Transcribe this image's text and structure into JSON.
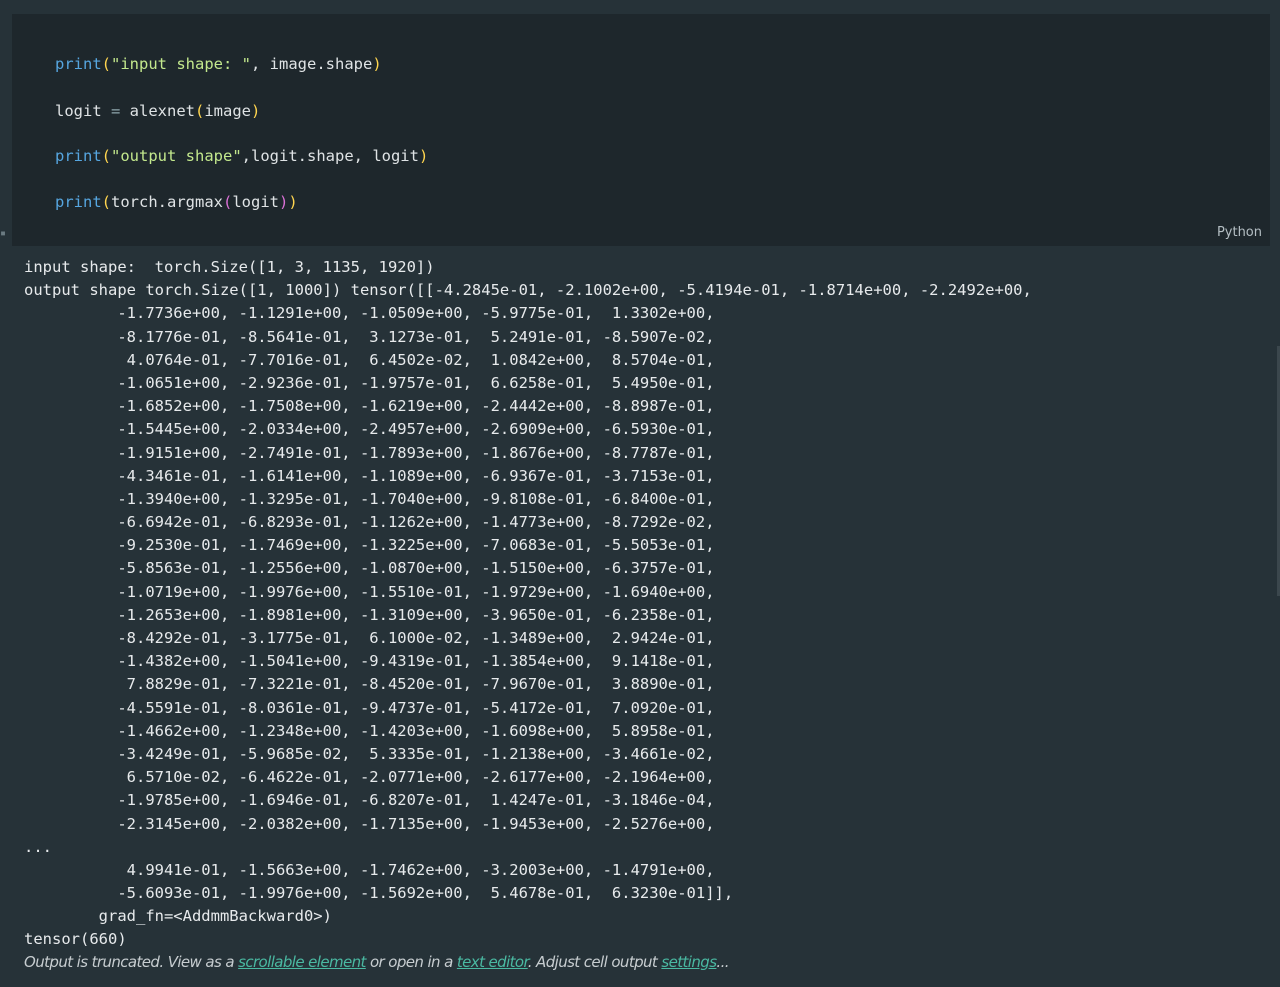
{
  "code_cell": {
    "language_label": "Python",
    "lines": [
      [
        {
          "t": "print",
          "c": "kw"
        },
        {
          "t": "(",
          "c": "paren"
        },
        {
          "t": "\"input shape: \"",
          "c": "str"
        },
        {
          "t": ", image.shape",
          "c": ""
        },
        {
          "t": ")",
          "c": "paren"
        }
      ],
      [
        {
          "t": "logit ",
          "c": ""
        },
        {
          "t": "=",
          "c": "op"
        },
        {
          "t": " alexnet",
          "c": ""
        },
        {
          "t": "(",
          "c": "paren"
        },
        {
          "t": "image",
          "c": ""
        },
        {
          "t": ")",
          "c": "paren"
        }
      ],
      [
        {
          "t": "print",
          "c": "kw"
        },
        {
          "t": "(",
          "c": "paren"
        },
        {
          "t": "\"output shape\"",
          "c": "str"
        },
        {
          "t": ",logit.shape, logit",
          "c": ""
        },
        {
          "t": ")",
          "c": "paren"
        }
      ],
      [
        {
          "t": "print",
          "c": "kw"
        },
        {
          "t": "(",
          "c": "paren"
        },
        {
          "t": "torch.argmax",
          "c": ""
        },
        {
          "t": "(",
          "c": "paren2"
        },
        {
          "t": "logit",
          "c": ""
        },
        {
          "t": ")",
          "c": "paren2"
        },
        {
          "t": ")",
          "c": "paren"
        }
      ]
    ]
  },
  "output": {
    "lines": [
      "input shape:  torch.Size([1, 3, 1135, 1920])",
      "output shape torch.Size([1, 1000]) tensor([[-4.2845e-01, -2.1002e+00, -5.4194e-01, -1.8714e+00, -2.2492e+00,",
      "          -1.7736e+00, -1.1291e+00, -1.0509e+00, -5.9775e-01,  1.3302e+00,",
      "          -8.1776e-01, -8.5641e-01,  3.1273e-01,  5.2491e-01, -8.5907e-02,",
      "           4.0764e-01, -7.7016e-01,  6.4502e-02,  1.0842e+00,  8.5704e-01,",
      "          -1.0651e+00, -2.9236e-01, -1.9757e-01,  6.6258e-01,  5.4950e-01,",
      "          -1.6852e+00, -1.7508e+00, -1.6219e+00, -2.4442e+00, -8.8987e-01,",
      "          -1.5445e+00, -2.0334e+00, -2.4957e+00, -2.6909e+00, -6.5930e-01,",
      "          -1.9151e+00, -2.7491e-01, -1.7893e+00, -1.8676e+00, -8.7787e-01,",
      "          -4.3461e-01, -1.6141e+00, -1.1089e+00, -6.9367e-01, -3.7153e-01,",
      "          -1.3940e+00, -1.3295e-01, -1.7040e+00, -9.8108e-01, -6.8400e-01,",
      "          -6.6942e-01, -6.8293e-01, -1.1262e+00, -1.4773e+00, -8.7292e-02,",
      "          -9.2530e-01, -1.7469e+00, -1.3225e+00, -7.0683e-01, -5.5053e-01,",
      "          -5.8563e-01, -1.2556e+00, -1.0870e+00, -1.5150e+00, -6.3757e-01,",
      "          -1.0719e+00, -1.9976e+00, -1.5510e-01, -1.9729e+00, -1.6940e+00,",
      "          -1.2653e+00, -1.8981e+00, -1.3109e+00, -3.9650e-01, -6.2358e-01,",
      "          -8.4292e-01, -3.1775e-01,  6.1000e-02, -1.3489e+00,  2.9424e-01,",
      "          -1.4382e+00, -1.5041e+00, -9.4319e-01, -1.3854e+00,  9.1418e-01,",
      "           7.8829e-01, -7.3221e-01, -8.4520e-01, -7.9670e-01,  3.8890e-01,",
      "          -4.5591e-01, -8.0361e-01, -9.4737e-01, -5.4172e-01,  7.0920e-01,",
      "          -1.4662e+00, -1.2348e+00, -1.4203e+00, -1.6098e+00,  5.8958e-01,",
      "          -3.4249e-01, -5.9685e-02,  5.3335e-01, -1.2138e+00, -3.4661e-02,",
      "           6.5710e-02, -6.4622e-01, -2.0771e+00, -2.6177e+00, -2.1964e+00,",
      "          -1.9785e+00, -1.6946e-01, -6.8207e-01,  1.4247e-01, -3.1846e-04,",
      "          -2.3145e+00, -2.0382e+00, -1.7135e+00, -1.9453e+00, -2.5276e+00,",
      "...",
      "           4.9941e-01, -1.5663e+00, -1.7462e+00, -3.2003e+00, -1.4791e+00,",
      "          -5.6093e-01, -1.9976e+00, -1.5692e+00,  5.4678e-01,  6.3230e-01]],",
      "        grad_fn=<AddmmBackward0>)",
      "tensor(660)"
    ]
  },
  "truncation": {
    "prefix": "Output is truncated. View as a ",
    "link_scrollable": "scrollable element",
    "middle": " or open in a ",
    "link_editor": "text editor",
    "middle2": ". Adjust cell output ",
    "link_settings": "settings",
    "suffix": "..."
  },
  "colors": {
    "background": "#263238",
    "code_background": "#1e272c",
    "keyword": "#56a6e0",
    "string": "#c3e88d",
    "paren": "#ffd54f",
    "paren_nested": "#da70d6",
    "link": "#4ab9a2"
  }
}
